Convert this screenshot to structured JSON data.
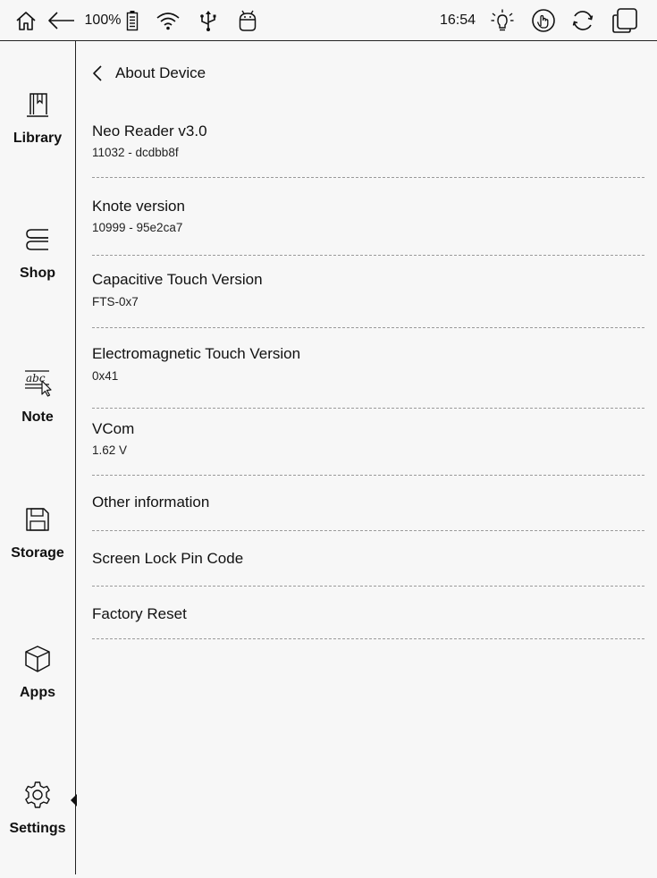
{
  "status_bar": {
    "battery_percent": "100%",
    "time": "16:54",
    "icons": [
      "home-icon",
      "back-arrow-icon",
      "battery-icon",
      "wifi-icon",
      "usb-icon",
      "android-debug-icon",
      "frontlight-icon",
      "touch-icon",
      "refresh-icon",
      "multi-window-icon"
    ]
  },
  "sidebar": {
    "items": [
      {
        "label": "Library",
        "icon": "library-icon"
      },
      {
        "label": "Shop",
        "icon": "shop-icon"
      },
      {
        "label": "Note",
        "icon": "note-icon"
      },
      {
        "label": "Storage",
        "icon": "storage-icon"
      },
      {
        "label": "Apps",
        "icon": "apps-icon"
      },
      {
        "label": "Settings",
        "icon": "gear-icon",
        "active": true
      }
    ]
  },
  "page": {
    "title": "About Device"
  },
  "info_items": [
    {
      "title": "Neo Reader v3.0",
      "value": "11032 - dcdbb8f"
    },
    {
      "title": "Knote version",
      "value": "10999 - 95e2ca7"
    },
    {
      "title": "Capacitive Touch Version",
      "value": "FTS-0x7"
    },
    {
      "title": "Electromagnetic Touch Version",
      "value": "0x41"
    },
    {
      "title": "VCom",
      "value": "1.62 V"
    }
  ],
  "action_items": [
    {
      "title": "Other information"
    },
    {
      "title": "Screen Lock Pin Code"
    },
    {
      "title": "Factory Reset"
    }
  ]
}
